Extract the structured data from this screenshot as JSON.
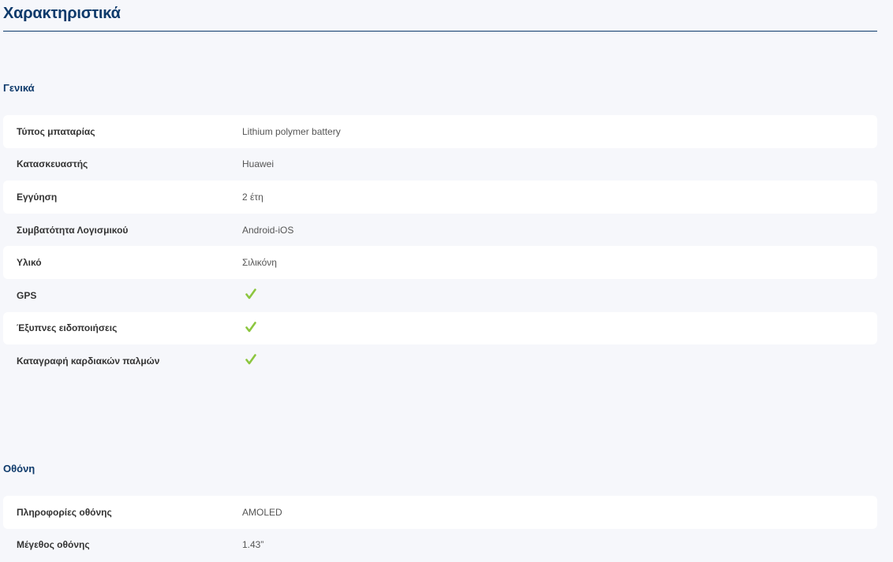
{
  "page": {
    "title": "Χαρακτηριστικά"
  },
  "colors": {
    "heading": "#0e3a6b",
    "background": "#f6f7fb",
    "row_shade": "#ffffff",
    "check": "#8cc63f"
  },
  "sections": [
    {
      "heading": "Γενικά",
      "rows": [
        {
          "label": "Τύπος μπαταρίας",
          "value": "Lithium polymer battery",
          "type": "text"
        },
        {
          "label": "Κατασκευαστής",
          "value": "Huawei",
          "type": "text"
        },
        {
          "label": "Εγγύηση",
          "value": "2 έτη",
          "type": "text"
        },
        {
          "label": "Συμβατότητα Λογισμικού",
          "value": "Android-iOS",
          "type": "text"
        },
        {
          "label": "Υλικό",
          "value": "Σιλικόνη",
          "type": "text"
        },
        {
          "label": "GPS",
          "value": "",
          "type": "check",
          "icon": "check-icon"
        },
        {
          "label": "Έξυπνες ειδοποιήσεις",
          "value": "",
          "type": "check",
          "icon": "check-icon"
        },
        {
          "label": "Καταγραφή καρδιακών παλμών",
          "value": "",
          "type": "check",
          "icon": "check-icon"
        }
      ]
    },
    {
      "heading": "Οθόνη",
      "rows": [
        {
          "label": "Πληροφορίες οθόνης",
          "value": "AMOLED",
          "type": "text"
        },
        {
          "label": "Μέγεθος οθόνης",
          "value": "1.43”",
          "type": "text"
        }
      ]
    }
  ]
}
